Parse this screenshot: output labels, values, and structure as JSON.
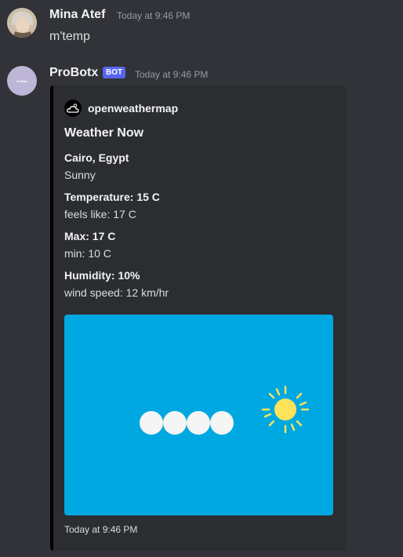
{
  "messages": [
    {
      "author": "Mina Atef",
      "timestamp": "Today at 9:46 PM",
      "content": "m'temp"
    },
    {
      "author": "ProBotx",
      "badge": "BOT",
      "timestamp": "Today at 9:46 PM",
      "avatar_text": "ProBot",
      "embed": {
        "author_name": "openweathermap",
        "title": "Weather Now",
        "fields": [
          {
            "name": "Cairo, Egypt",
            "value": "Sunny"
          },
          {
            "name": "Temperature: 15 C",
            "value": "feels like: 17 C"
          },
          {
            "name": "Max: 17  C",
            "value": "min: 10 C"
          },
          {
            "name": "Humidity: 10%",
            "value": "wind speed: 12 km/hr"
          }
        ],
        "footer": "Today at 9:46 PM",
        "colors": {
          "sidebar": "#000000",
          "image_bg": "#00a8e1",
          "sun": "#fde35a",
          "cloud": "#f5f5f5"
        }
      }
    }
  ]
}
